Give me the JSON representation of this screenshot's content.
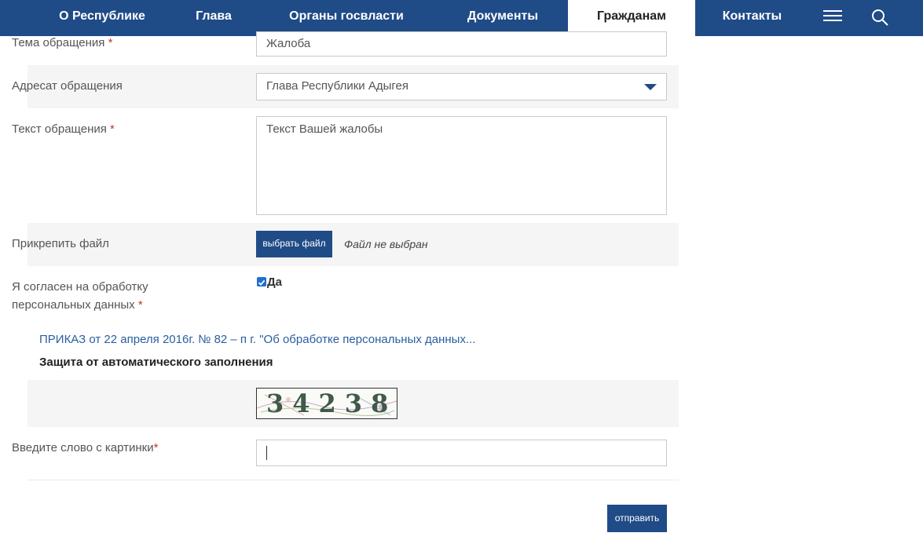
{
  "nav": {
    "items": [
      {
        "label": "О Республике"
      },
      {
        "label": "Глава"
      },
      {
        "label": "Органы госвласти"
      },
      {
        "label": "Документы"
      },
      {
        "label": "Гражданам",
        "active": true
      },
      {
        "label": "Контакты"
      }
    ],
    "icons": [
      "menu-icon",
      "search-icon"
    ]
  },
  "form": {
    "subject": {
      "label": "Тема обращения",
      "required_mark": "*",
      "value": "Жалоба"
    },
    "addressee": {
      "label": "Адресат обращения",
      "value": "Глава Республики Адыгея"
    },
    "text": {
      "label": "Текст обращения",
      "required_mark": "*",
      "value": "Текст Вашей жалобы"
    },
    "attach": {
      "label": "Прикрепить файл",
      "button": "выбрать файл",
      "status": "Файл не выбран"
    },
    "consent": {
      "label_line1": "Я согласен на обработку",
      "label_line2": "персональных данных",
      "required_mark": "*",
      "checkbox_label": "Да",
      "checked": true
    },
    "order_link": "ПРИКАЗ от 22 апреля 2016г. № 82 – п г. \"Об обработке персональных данных...",
    "captcha_section_title": "Защита от автоматического заполнения",
    "captcha_digits": "34238",
    "captcha_input": {
      "label": "Введите слово с картинки",
      "required_mark": "*",
      "value": ""
    },
    "submit": "отправить"
  },
  "colors": {
    "brand": "#1f4b87",
    "required": "#c0392b",
    "link": "#2a5ea1",
    "row_shade": "#f5f5f5"
  }
}
